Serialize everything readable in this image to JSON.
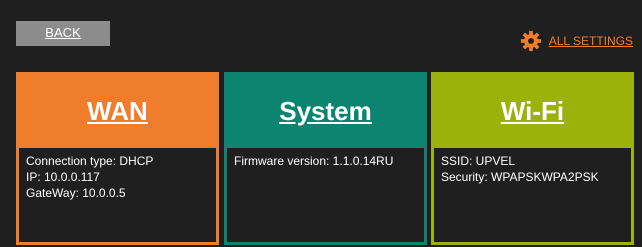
{
  "header": {
    "back_label": "BACK",
    "all_settings_label": "ALL SETTINGS"
  },
  "colors": {
    "wan": "#f07d2b",
    "system": "#0d8470",
    "wifi": "#9ab20a",
    "background": "#1f1f1f",
    "back_button": "#8c8c8c"
  },
  "panels": {
    "wan": {
      "title": "WAN",
      "lines": [
        "Connection type: DHCP",
        "IP: 10.0.0.117",
        "GateWay: 10.0.0.5"
      ]
    },
    "system": {
      "title": "System",
      "lines": [
        "Firmware version: 1.1.0.14RU"
      ]
    },
    "wifi": {
      "title": "Wi-Fi",
      "lines": [
        "SSID: UPVEL",
        "Security: WPAPSKWPA2PSK"
      ]
    }
  },
  "icons": {
    "settings": "gear-icon"
  }
}
